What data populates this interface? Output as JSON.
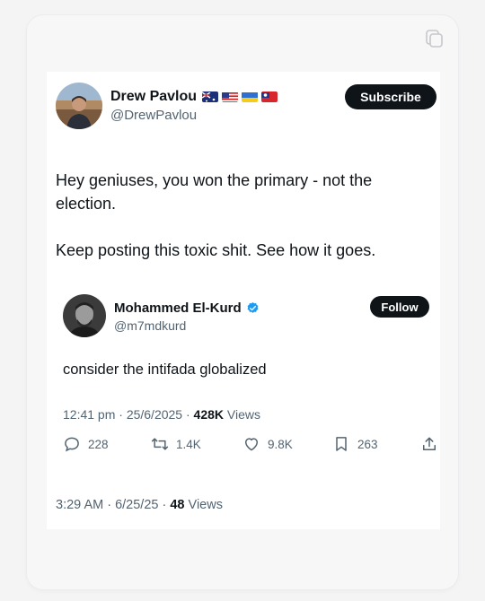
{
  "main_tweet": {
    "author_name": "Drew Pavlou",
    "handle": "@DrewPavlou",
    "flags": [
      "australia-flag",
      "usa-flag",
      "ukraine-flag",
      "taiwan-flag"
    ],
    "subscribe_label": "Subscribe",
    "text_line1": "Hey geniuses, you won the primary - not the election.",
    "text_line2": "Keep posting this toxic shit. See how it goes.",
    "time": "3:29 AM · 6/25/25 ·",
    "views_count": "48",
    "views_label": "Views"
  },
  "quoted_tweet": {
    "author_name": "Mohammed El-Kurd",
    "handle": "@m7mdkurd",
    "follow_label": "Follow",
    "text": "consider the intifada globalized",
    "time": "12:41 pm · 25/6/2025 ·",
    "views_count": "428K",
    "views_label": "Views",
    "replies": "228",
    "retweets": "1.4K",
    "likes": "9.8K",
    "bookmarks": "263"
  },
  "colors": {
    "verified": "#1d9bf0",
    "button_bg": "#0f1419",
    "secondary_text": "#536471"
  }
}
